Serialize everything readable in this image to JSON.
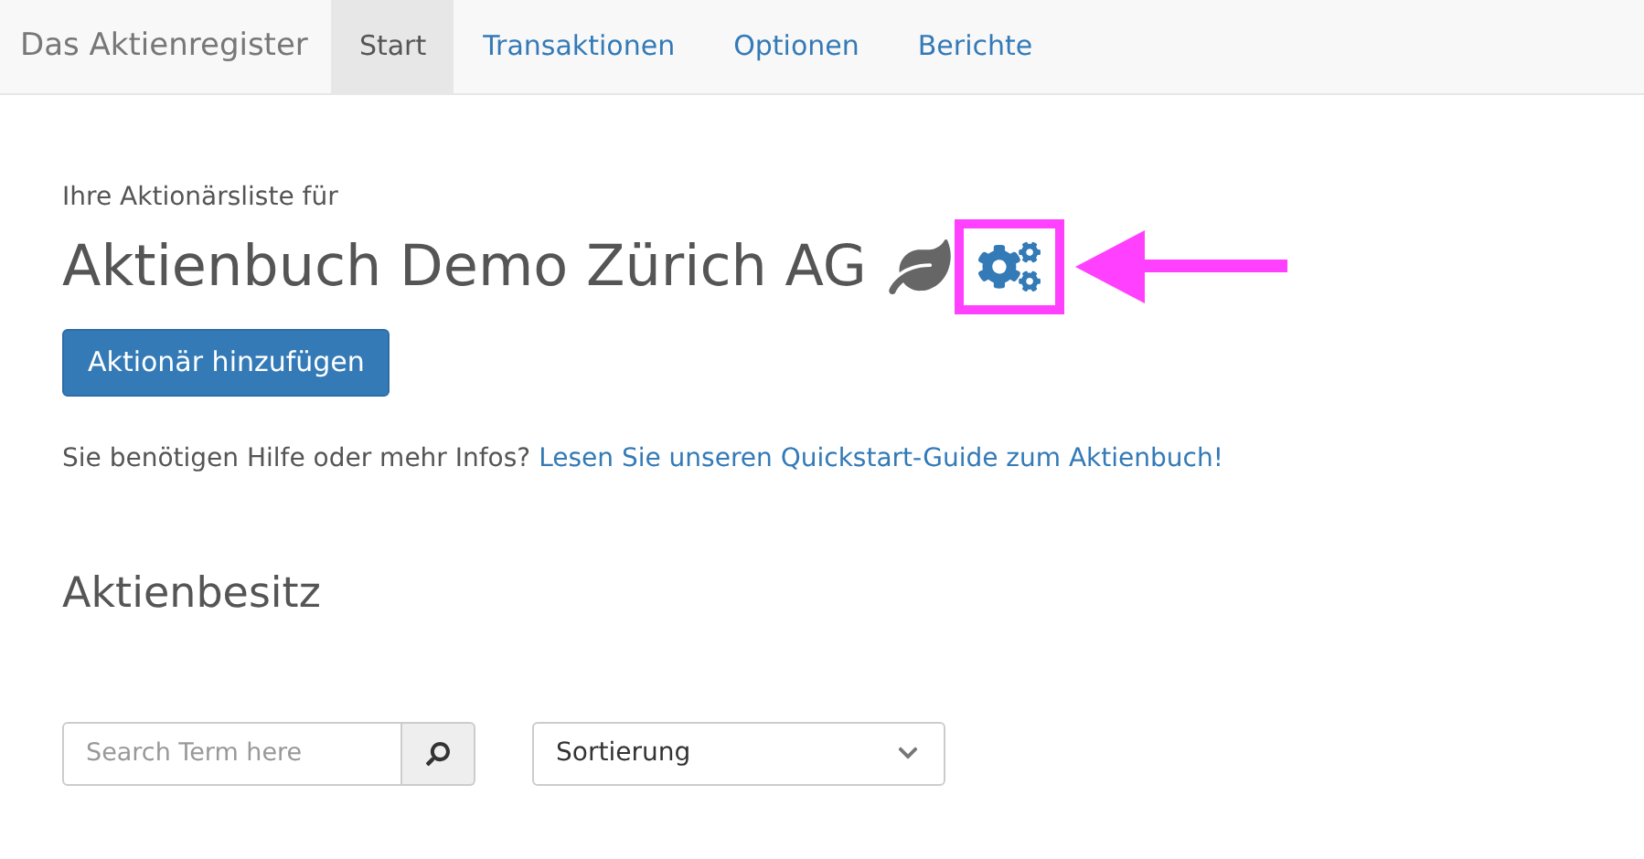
{
  "navbar": {
    "brand": "Das Aktienregister",
    "tabs": [
      {
        "label": "Start",
        "selected": true
      },
      {
        "label": "Transaktionen",
        "selected": false
      },
      {
        "label": "Optionen",
        "selected": false
      },
      {
        "label": "Berichte",
        "selected": false
      }
    ]
  },
  "header": {
    "subtitle": "Ihre Aktionärsliste für",
    "title": "Aktienbuch Demo Zürich AG"
  },
  "add_button": "Aktionär hinzufügen",
  "help": {
    "text": "Sie benötigen Hilfe oder mehr Infos?",
    "link": "Lesen Sie unseren Quickstart-Guide zum Aktienbuch!"
  },
  "section_title": "Aktienbesitz",
  "search": {
    "placeholder": "Search Term here"
  },
  "sort": {
    "value": "Sortierung"
  }
}
